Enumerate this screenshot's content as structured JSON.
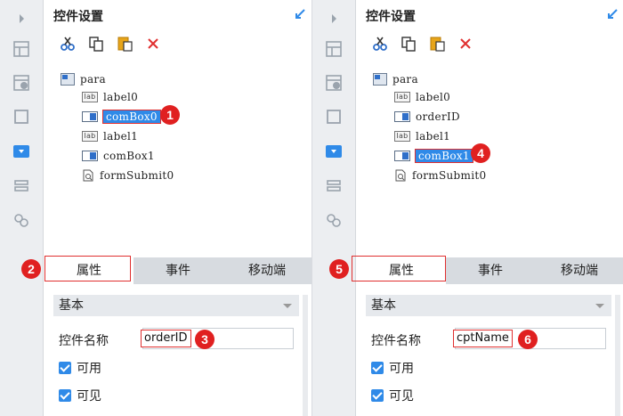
{
  "panels": [
    {
      "title": "控件设置",
      "tree": {
        "root": "para",
        "items": [
          "label0",
          "comBox0",
          "label1",
          "comBox1",
          "formSubmit0"
        ]
      },
      "tabs": [
        "属性",
        "事件",
        "移动端"
      ],
      "section_label": "基本",
      "property_label": "控件名称",
      "property_value": "orderID",
      "checks": [
        "可用",
        "可见"
      ],
      "markers": [
        "1",
        "2",
        "3"
      ]
    },
    {
      "title": "控件设置",
      "tree": {
        "root": "para",
        "items": [
          "label0",
          "orderID",
          "label1",
          "comBox1",
          "formSubmit0"
        ]
      },
      "tabs": [
        "属性",
        "事件",
        "移动端"
      ],
      "section_label": "基本",
      "property_label": "控件名称",
      "property_value": "cptName",
      "checks": [
        "可用",
        "可见"
      ],
      "markers": [
        "4",
        "5",
        "6"
      ]
    }
  ],
  "colors": {
    "accent": "#2f8ae8",
    "highlight": "#e03030",
    "marker": "#e02020"
  },
  "icons": {
    "rail": [
      "expand-arrow-icon",
      "layout-icon",
      "info-layout-icon",
      "frame-icon",
      "combobox-icon",
      "widget-stack-icon",
      "link-icon"
    ],
    "toolbar": [
      "cut-icon",
      "copy-icon",
      "paste-icon",
      "delete-icon"
    ]
  }
}
